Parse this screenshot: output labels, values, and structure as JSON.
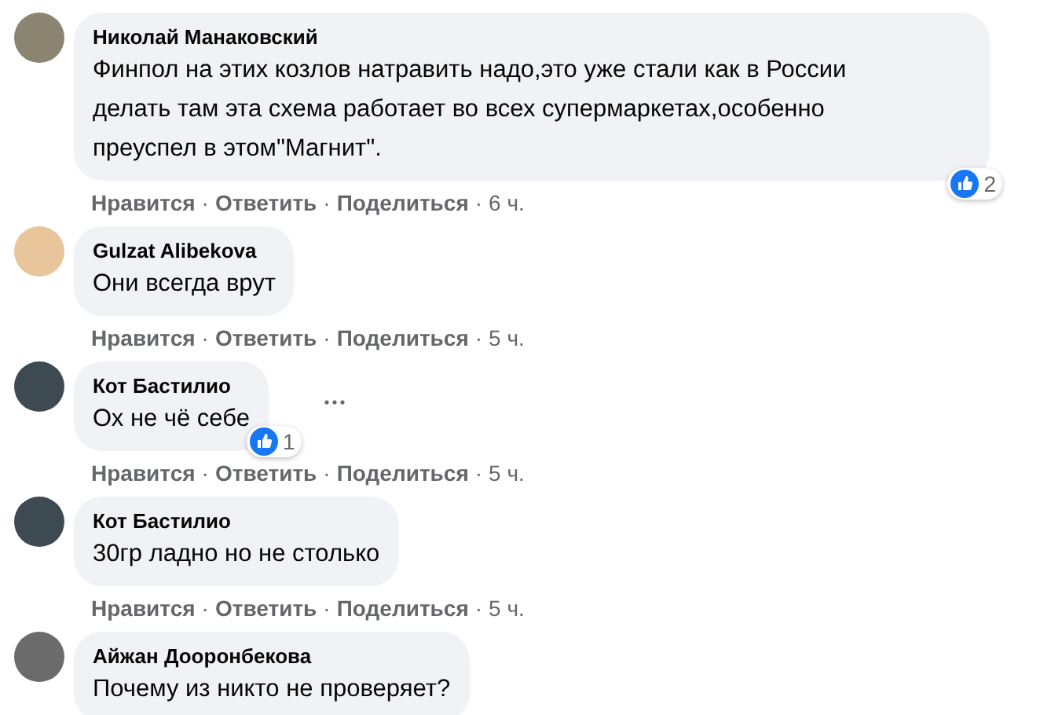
{
  "comments": [
    {
      "author": "Николай Манаковский",
      "text": "Финпол на этих козлов натравить надо,это уже стали как в России делать там эта схема работает во всех супермаркетах,особенно преуспел в этом\"Магнит\".",
      "reactions": "2",
      "menu": false,
      "actions": [
        "Нравится",
        "Ответить",
        "Поделиться"
      ],
      "separator": "·",
      "time": "6 ч."
    },
    {
      "author": "Gulzat Alibekova",
      "text": "Они всегда врут",
      "menu": false,
      "actions": [
        "Нравится",
        "Ответить",
        "Поделиться"
      ],
      "separator": "·",
      "time": "5 ч."
    },
    {
      "author": "Кот Бастилио",
      "text": "Ох не чё себе",
      "reactions": "1",
      "menu": true,
      "actions": [
        "Нравится",
        "Ответить",
        "Поделиться"
      ],
      "separator": "·",
      "time": "5 ч."
    },
    {
      "author": "Кот Бастилио",
      "text": "30гр ладно но не столько",
      "menu": false,
      "actions": [
        "Нравится",
        "Ответить",
        "Поделиться"
      ],
      "separator": "·",
      "time": "5 ч."
    },
    {
      "author": "Айжан Дооронбекова",
      "text": "Почему из никто не проверяет?",
      "menu": false
    }
  ]
}
